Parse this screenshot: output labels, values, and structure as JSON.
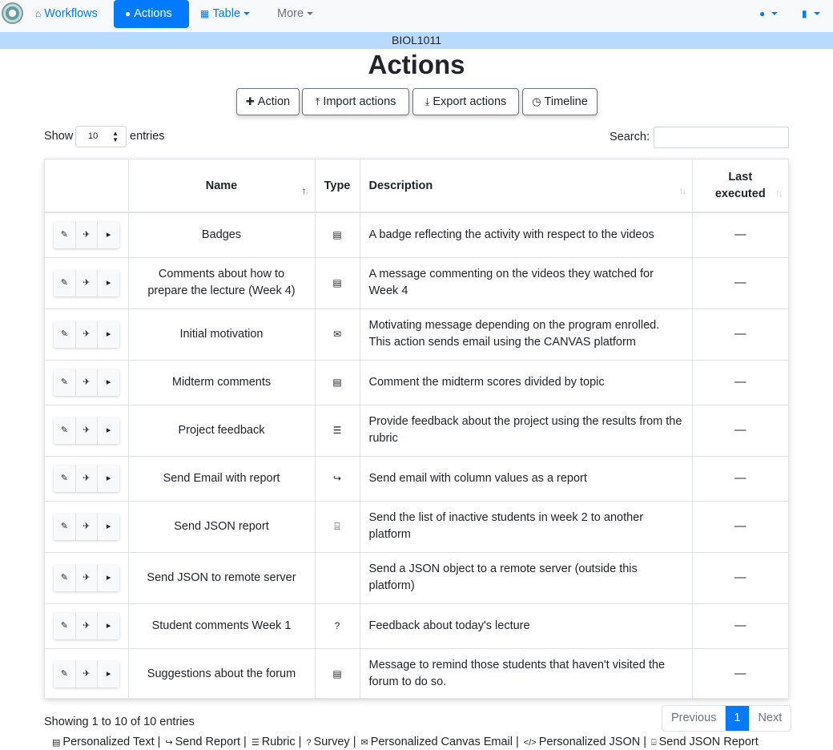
{
  "navbar": {
    "items": [
      {
        "label": "Workflows",
        "icon": "home-icon"
      },
      {
        "label": "Actions",
        "icon": "comments-icon"
      },
      {
        "label": "Table",
        "icon": "table-icon"
      },
      {
        "label": "More"
      }
    ]
  },
  "course": "BIOL1011",
  "page_title": "Actions",
  "toolbar": {
    "action": "Action",
    "import": "Import actions",
    "export": "Export actions",
    "timeline": "Timeline"
  },
  "length": {
    "show": "Show",
    "value": "10",
    "entries": "entries"
  },
  "search": {
    "label": "Search:",
    "value": ""
  },
  "table": {
    "headers": {
      "name": "Name",
      "type": "Type",
      "description": "Description",
      "last_executed_1": "Last",
      "last_executed_2": "executed"
    },
    "rows": [
      {
        "name": "Badges",
        "type": "personalized-text-icon",
        "description": "A badge reflecting the activity with respect to the videos",
        "last": "—"
      },
      {
        "name": "Comments about how to prepare the lecture (Week 4)",
        "type": "personalized-text-icon",
        "description": "A message commenting on the videos they watched for Week 4",
        "last": "—"
      },
      {
        "name": "Initial motivation",
        "type": "canvas-email-icon",
        "description": "Motivating message depending on the program enrolled. This action sends email using the CANVAS platform",
        "last": "—"
      },
      {
        "name": "Midterm comments",
        "type": "personalized-text-icon",
        "description": "Comment the midterm scores divided by topic",
        "last": "—"
      },
      {
        "name": "Project feedback",
        "type": "rubric-icon",
        "description": "Provide feedback about the project using the results from the rubric",
        "last": "—"
      },
      {
        "name": "Send Email with report",
        "type": "send-report-icon",
        "description": "Send email with column values as a report",
        "last": "—"
      },
      {
        "name": "Send JSON report",
        "type": "json-report-icon",
        "description": "Send the list of inactive students in week 2 to another platform",
        "last": "—"
      },
      {
        "name": "Send JSON to remote server",
        "type": "json-icon",
        "description": "Send a JSON object to a remote server (outside this platform)",
        "last": "—"
      },
      {
        "name": "Student comments Week 1",
        "type": "survey-icon",
        "description": "Feedback about today's lecture",
        "last": "—"
      },
      {
        "name": "Suggestions about the forum",
        "type": "personalized-text-icon",
        "description": "Message to remind those students that haven't visited the forum to do so.",
        "last": "—"
      }
    ]
  },
  "info": "Showing 1 to 10 of 10 entries",
  "pagination": {
    "previous": "Previous",
    "current": "1",
    "next": "Next"
  },
  "legend": [
    {
      "icon": "personalized-text-icon",
      "label": "Personalized Text |"
    },
    {
      "icon": "send-report-icon",
      "label": "Send Report |"
    },
    {
      "icon": "rubric-icon",
      "label": "Rubric |"
    },
    {
      "icon": "survey-icon",
      "label": "Survey |"
    },
    {
      "icon": "canvas-email-icon",
      "label": "Personalized Canvas Email |"
    },
    {
      "icon": "json-icon",
      "label": "Personalized JSON |"
    },
    {
      "icon": "json-report-icon",
      "label": "Send JSON Report"
    }
  ],
  "colors": {
    "primary": "#007bff",
    "course_bar": "#b8daff",
    "navbar_bg": "#f8f9fa"
  }
}
